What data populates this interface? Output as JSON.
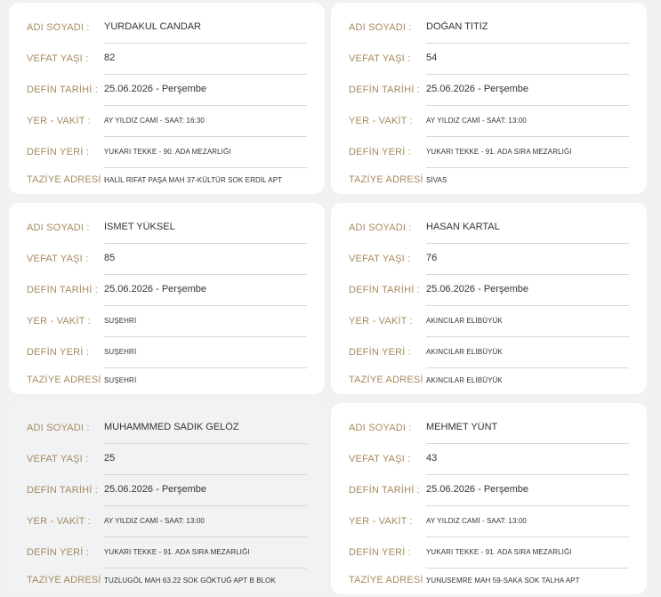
{
  "labels": {
    "name": "ADI SOYADI :",
    "age": "VEFAT YAŞI :",
    "date": "DEFİN TARİHİ :",
    "place_time": "YER - VAKİT :",
    "burial": "DEFİN YERİ :",
    "condolence": "TAZİYE ADRESİ :"
  },
  "records": [
    {
      "name": "YURDAKUL CANDAR",
      "age": "82",
      "date": "25.06.2026 - Perşembe",
      "place_time": "AY YILDIZ CAMİ - SAAT: 16:30",
      "burial": "YUKARI TEKKE - 90. ADA MEZARLIĞI",
      "condolence": "HALİL RIFAT PAŞA MAH 37-KÜLTÜR SOK ERDİL APT"
    },
    {
      "name": "DOĞAN TİTİZ",
      "age": "54",
      "date": "25.06.2026 - Perşembe",
      "place_time": "AY YILDIZ CAMİ - SAAT: 13:00",
      "burial": "YUKARI TEKKE - 91. ADA SIRA MEZARLIĞI",
      "condolence": "SİVAS"
    },
    {
      "name": "İSMET YÜKSEL",
      "age": "85",
      "date": "25.06.2026 - Perşembe",
      "place_time": "SUŞEHRİ",
      "burial": "SUŞEHRİ",
      "condolence": "SUŞEHRİ"
    },
    {
      "name": "HASAN KARTAL",
      "age": "76",
      "date": "25.06.2026 - Perşembe",
      "place_time": "AKINCILAR ELİBÜYÜK",
      "burial": "AKINCILAR ELİBÜYÜK",
      "condolence": "AKINCILAR ELİBÜYÜK"
    },
    {
      "name": "MUHAMMMED SADIK GELÖZ",
      "age": "25",
      "date": "25.06.2026 - Perşembe",
      "place_time": "AY YILDIZ CAMİ - SAAT: 13:00",
      "burial": "YUKARI TEKKE - 91. ADA SIRA MEZARLIĞI",
      "condolence": "TUZLUGÖL MAH 63.22 SOK GÖKTUĞ APT B BLOK"
    },
    {
      "name": "MEHMET YÜNT",
      "age": "43",
      "date": "25.06.2026 - Perşembe",
      "place_time": "AY YILDIZ CAMİ - SAAT: 13:00",
      "burial": "YUKARI TEKKE - 91. ADA SIRA MEZARLIĞI",
      "condolence": "YUNUSEMRE MAH 59-SAKA SOK TALHA APT"
    }
  ],
  "colors": {
    "label": "#a68a5d",
    "value": "#333333",
    "card": "#ffffff",
    "card_highlight": "#f1f2f4",
    "background": "#f1f1f3"
  }
}
